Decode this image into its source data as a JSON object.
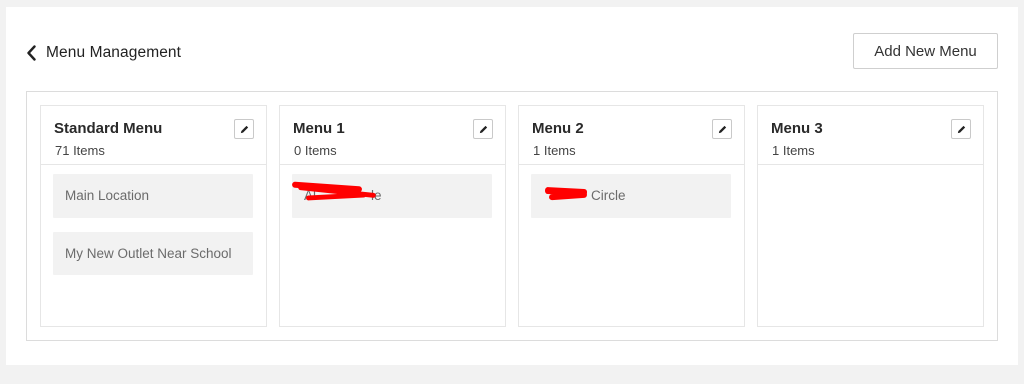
{
  "header": {
    "title": "Menu Management",
    "add_button_label": "Add New Menu"
  },
  "icons": {
    "back": "chevron-left-icon",
    "edit": "pencil-icon"
  },
  "columns": [
    {
      "title": "Standard Menu",
      "count": "71 Items",
      "items": [
        {
          "label": "Main Location"
        },
        {
          "label": "My New Outlet Near School"
        }
      ]
    },
    {
      "title": "Menu 1",
      "count": "0 Items",
      "items": [
        {
          "label": "Al",
          "label_tail": "le",
          "redacted": true
        }
      ]
    },
    {
      "title": "Menu 2",
      "count": "1 Items",
      "items": [
        {
          "label": "",
          "label_tail": "Circle",
          "redacted": true
        }
      ]
    },
    {
      "title": "Menu 3",
      "count": "1 Items",
      "items": []
    }
  ],
  "colors": {
    "redaction": "#ff0000",
    "item_background": "#f2f2f2",
    "border": "#dcdcdc"
  }
}
